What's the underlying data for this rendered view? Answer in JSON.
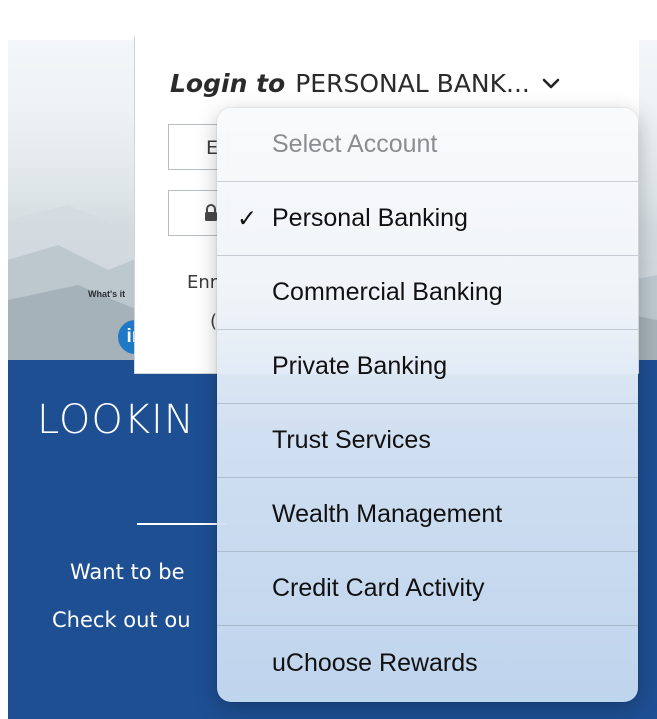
{
  "hero": {
    "whats_text": "What's it",
    "badge_text": "in",
    "edge_letter": "E"
  },
  "login": {
    "prefix": "Login to",
    "account": "PERSONAL BANK...",
    "email_field_partial": "E",
    "panel_text_1": "Enr",
    "panel_text_2": "("
  },
  "banner": {
    "title": "LOOKIN",
    "line1": "Want to be",
    "line2": "Check out ou"
  },
  "dropdown": {
    "header": "Select Account",
    "selected_index": 0,
    "options": [
      {
        "label": "Personal Banking",
        "check": "✓"
      },
      {
        "label": "Commercial Banking"
      },
      {
        "label": "Private Banking"
      },
      {
        "label": "Trust Services"
      },
      {
        "label": "Wealth Management"
      },
      {
        "label": "Credit Card Activity"
      },
      {
        "label": "uChoose Rewards"
      }
    ]
  },
  "colors": {
    "banner_blue": "#1e4f93",
    "badge_blue": "#1f79c4",
    "text_dark": "#2b2b2b",
    "header_gray": "#8a8d91"
  }
}
